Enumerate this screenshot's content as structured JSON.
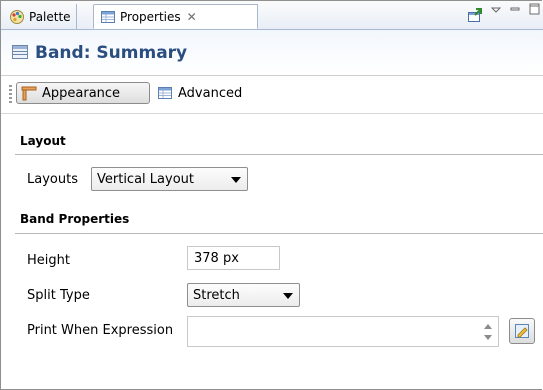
{
  "tabs": {
    "palette_label": "Palette",
    "properties_label": "Properties",
    "close_glyph": "✕"
  },
  "header": {
    "title": "Band: Summary"
  },
  "subtabs": {
    "appearance_label": "Appearance",
    "advanced_label": "Advanced"
  },
  "layout_section": {
    "title": "Layout",
    "layouts_label": "Layouts",
    "layouts_value": "Vertical Layout"
  },
  "band_section": {
    "title": "Band Properties",
    "height_label": "Height",
    "height_value": "378 px",
    "split_type_label": "Split Type",
    "split_type_value": "Stretch",
    "print_when_label": "Print When Expression",
    "print_when_value": ""
  },
  "icons": {
    "palette": "palette-icon",
    "properties": "properties-table-icon",
    "band": "band-icon",
    "appearance": "appearance-icon",
    "advanced": "advanced-table-icon",
    "pin": "pin-icon",
    "view_menu": "view-menu-icon",
    "minimize": "minimize-icon",
    "maximize": "maximize-icon",
    "expression_editor": "expression-editor-icon"
  }
}
